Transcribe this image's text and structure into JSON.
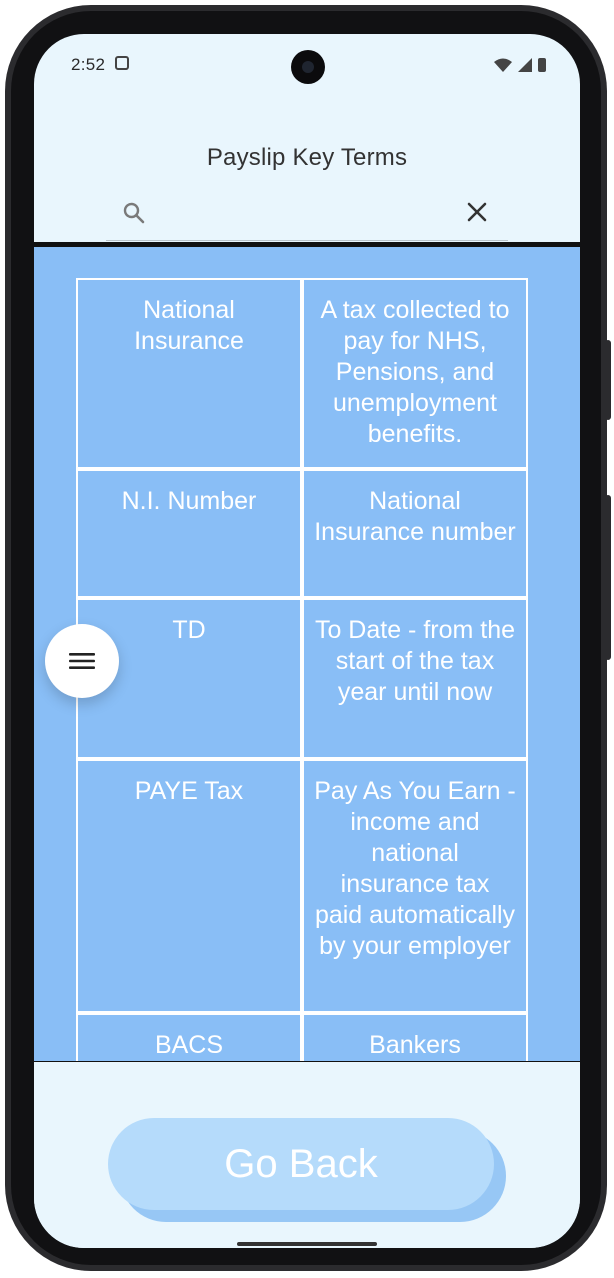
{
  "status_bar": {
    "time": "2:52"
  },
  "header": {
    "title": "Payslip Key Terms"
  },
  "search": {
    "value": "",
    "placeholder": ""
  },
  "terms": [
    {
      "term": "National Insurance",
      "definition": "A tax collected to pay for NHS, Pensions, and unemployment benefits."
    },
    {
      "term": "N.I. Number",
      "definition": "National Insurance number"
    },
    {
      "term": "TD",
      "definition": "To Date - from the start of the tax year until now"
    },
    {
      "term": "PAYE Tax",
      "definition": "Pay As You Earn - income and national insurance tax paid automatically by your employer"
    },
    {
      "term": "BACS",
      "definition": "Bankers"
    }
  ],
  "footer": {
    "go_back_label": "Go Back"
  },
  "colors": {
    "list_background": "#89bef6",
    "screen_background": "#e9f6fd",
    "button": "#b5dbfb"
  }
}
